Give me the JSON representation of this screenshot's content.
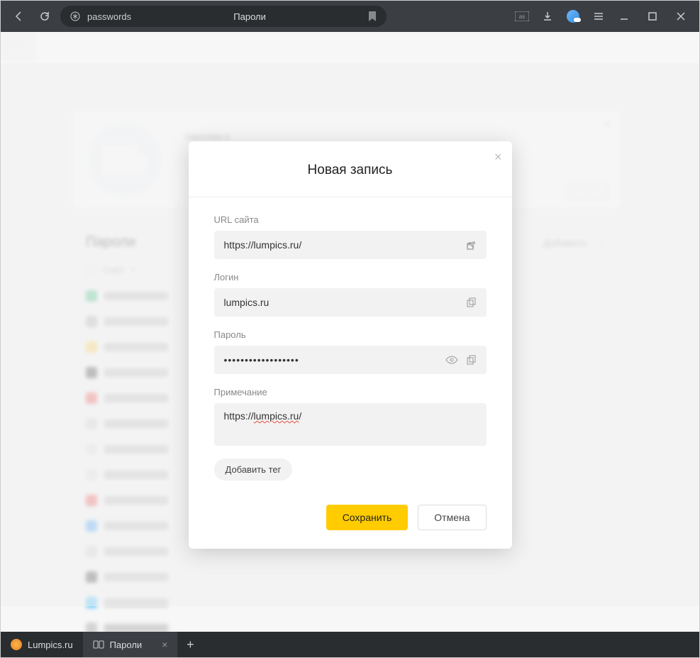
{
  "toolbar": {
    "url_text": "passwords",
    "page_title": "Пароли"
  },
  "background": {
    "card_text": "паролям и",
    "list_title": "Пароли",
    "add_label": "Добавить",
    "col_site": "Сайт"
  },
  "modal": {
    "title": "Новая запись",
    "url_label": "URL сайта",
    "url_value": "https://lumpics.ru/",
    "login_label": "Логин",
    "login_value": "lumpics.ru",
    "password_label": "Пароль",
    "password_value": "••••••••••••••••••",
    "note_label": "Примечание",
    "note_prefix": "https://",
    "note_underlined": "lumpics.ru",
    "note_suffix": "/",
    "add_tag": "Добавить тег",
    "save": "Сохранить",
    "cancel": "Отмена"
  },
  "tabs": {
    "tab1": "Lumpics.ru",
    "tab2": "Пароли"
  }
}
